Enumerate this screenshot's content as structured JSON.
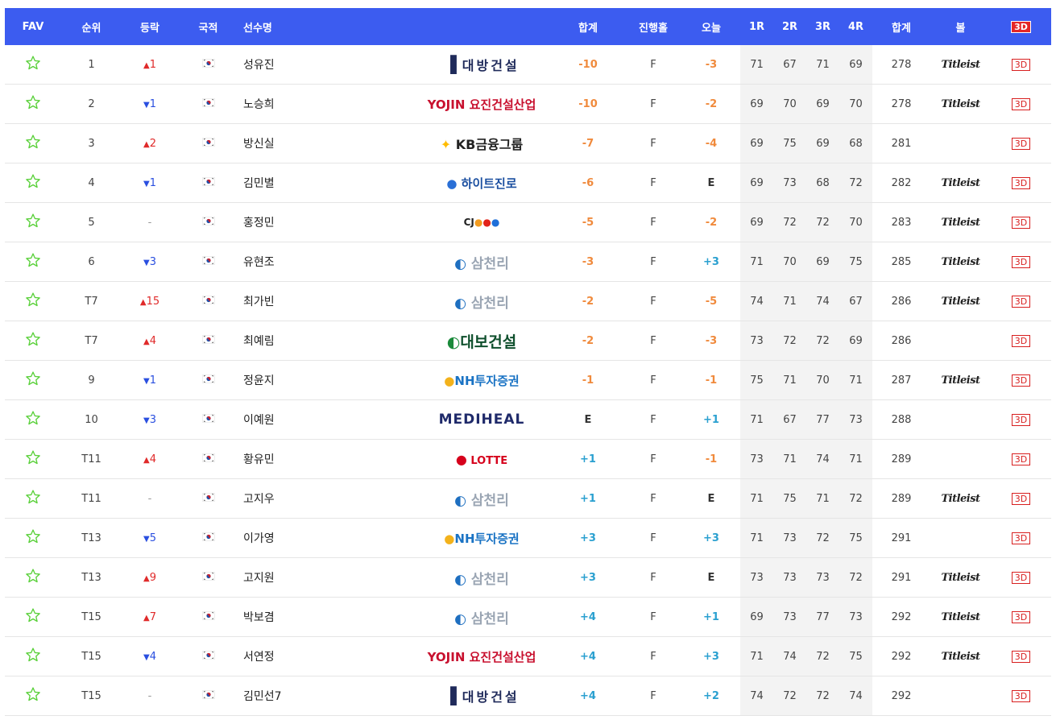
{
  "columns": {
    "fav": "FAV",
    "rank": "순위",
    "movement": "등락",
    "nationality": "국적",
    "player": "선수명",
    "total_to_par": "합계",
    "thru": "진행홀",
    "today": "오늘",
    "r1": "1R",
    "r2": "2R",
    "r3": "3R",
    "r4": "4R",
    "total_strokes": "합계",
    "ball": "볼",
    "view3d": "3D"
  },
  "colors": {
    "header_bg": "#3c5cf0",
    "up": "#e02a2a",
    "down": "#2a4fe0",
    "under_par": "#f08a3c",
    "over_par": "#2aa0d0",
    "star": "#59d039"
  },
  "rows": [
    {
      "rank": "1",
      "dir": "up",
      "move": "1",
      "flag": "korea-flag-icon",
      "name": "성유진",
      "sponsor": "대방건설",
      "sponsor_key": "daebang",
      "total": "-10",
      "total_class": "neg",
      "thru": "F",
      "today": "-3",
      "today_class": "neg",
      "r1": "71",
      "r2": "67",
      "r3": "71",
      "r4": "69",
      "strokes": "278",
      "ball": "Titleist",
      "btn": "3D"
    },
    {
      "rank": "2",
      "dir": "down",
      "move": "1",
      "flag": "korea-flag-icon",
      "name": "노승희",
      "sponsor": "YOJIN 요진건설산업",
      "sponsor_key": "yojin",
      "total": "-10",
      "total_class": "neg",
      "thru": "F",
      "today": "-2",
      "today_class": "neg",
      "r1": "69",
      "r2": "70",
      "r3": "69",
      "r4": "70",
      "strokes": "278",
      "ball": "Titleist",
      "btn": "3D"
    },
    {
      "rank": "3",
      "dir": "up",
      "move": "2",
      "flag": "korea-flag-icon",
      "name": "방신실",
      "sponsor": "KB금융그룹",
      "sponsor_key": "kb",
      "total": "-7",
      "total_class": "neg",
      "thru": "F",
      "today": "-4",
      "today_class": "neg",
      "r1": "69",
      "r2": "75",
      "r3": "69",
      "r4": "68",
      "strokes": "281",
      "ball": "",
      "btn": "3D"
    },
    {
      "rank": "4",
      "dir": "down",
      "move": "1",
      "flag": "korea-flag-icon",
      "name": "김민별",
      "sponsor": "하이트진로",
      "sponsor_key": "hite",
      "total": "-6",
      "total_class": "neg",
      "thru": "F",
      "today": "E",
      "today_class": "even",
      "r1": "69",
      "r2": "73",
      "r3": "68",
      "r4": "72",
      "strokes": "282",
      "ball": "Titleist",
      "btn": "3D"
    },
    {
      "rank": "5",
      "dir": "same",
      "move": "-",
      "flag": "korea-flag-icon",
      "name": "홍정민",
      "sponsor": "CJ",
      "sponsor_key": "cj",
      "total": "-5",
      "total_class": "neg",
      "thru": "F",
      "today": "-2",
      "today_class": "neg",
      "r1": "69",
      "r2": "72",
      "r3": "72",
      "r4": "70",
      "strokes": "283",
      "ball": "Titleist",
      "btn": "3D"
    },
    {
      "rank": "6",
      "dir": "down",
      "move": "3",
      "flag": "korea-flag-icon",
      "name": "유현조",
      "sponsor": "삼천리",
      "sponsor_key": "samchully",
      "total": "-3",
      "total_class": "neg",
      "thru": "F",
      "today": "+3",
      "today_class": "pos",
      "r1": "71",
      "r2": "70",
      "r3": "69",
      "r4": "75",
      "strokes": "285",
      "ball": "Titleist",
      "btn": "3D"
    },
    {
      "rank": "T7",
      "dir": "up",
      "move": "15",
      "flag": "korea-flag-icon",
      "name": "최가빈",
      "sponsor": "삼천리",
      "sponsor_key": "samchully",
      "total": "-2",
      "total_class": "neg",
      "thru": "F",
      "today": "-5",
      "today_class": "neg",
      "r1": "74",
      "r2": "71",
      "r3": "74",
      "r4": "67",
      "strokes": "286",
      "ball": "Titleist",
      "btn": "3D"
    },
    {
      "rank": "T7",
      "dir": "up",
      "move": "4",
      "flag": "korea-flag-icon",
      "name": "최예림",
      "sponsor": "대보건설",
      "sponsor_key": "daebo",
      "total": "-2",
      "total_class": "neg",
      "thru": "F",
      "today": "-3",
      "today_class": "neg",
      "r1": "73",
      "r2": "72",
      "r3": "72",
      "r4": "69",
      "strokes": "286",
      "ball": "",
      "btn": "3D"
    },
    {
      "rank": "9",
      "dir": "down",
      "move": "1",
      "flag": "korea-flag-icon",
      "name": "정윤지",
      "sponsor": "NH투자증권",
      "sponsor_key": "nh",
      "total": "-1",
      "total_class": "neg",
      "thru": "F",
      "today": "-1",
      "today_class": "neg",
      "r1": "75",
      "r2": "71",
      "r3": "70",
      "r4": "71",
      "strokes": "287",
      "ball": "Titleist",
      "btn": "3D"
    },
    {
      "rank": "10",
      "dir": "down",
      "move": "3",
      "flag": "korea-flag-icon",
      "name": "이예원",
      "sponsor": "MEDIHEAL",
      "sponsor_key": "mediheal",
      "total": "E",
      "total_class": "even",
      "thru": "F",
      "today": "+1",
      "today_class": "pos",
      "r1": "71",
      "r2": "67",
      "r3": "77",
      "r4": "73",
      "strokes": "288",
      "ball": "",
      "btn": "3D"
    },
    {
      "rank": "T11",
      "dir": "up",
      "move": "4",
      "flag": "korea-flag-icon",
      "name": "황유민",
      "sponsor": "LOTTE",
      "sponsor_key": "lotte",
      "total": "+1",
      "total_class": "pos",
      "thru": "F",
      "today": "-1",
      "today_class": "neg",
      "r1": "73",
      "r2": "71",
      "r3": "74",
      "r4": "71",
      "strokes": "289",
      "ball": "",
      "btn": "3D"
    },
    {
      "rank": "T11",
      "dir": "same",
      "move": "-",
      "flag": "korea-flag-icon",
      "name": "고지우",
      "sponsor": "삼천리",
      "sponsor_key": "samchully",
      "total": "+1",
      "total_class": "pos",
      "thru": "F",
      "today": "E",
      "today_class": "even",
      "r1": "71",
      "r2": "75",
      "r3": "71",
      "r4": "72",
      "strokes": "289",
      "ball": "Titleist",
      "btn": "3D"
    },
    {
      "rank": "T13",
      "dir": "down",
      "move": "5",
      "flag": "korea-flag-icon",
      "name": "이가영",
      "sponsor": "NH투자증권",
      "sponsor_key": "nh",
      "total": "+3",
      "total_class": "pos",
      "thru": "F",
      "today": "+3",
      "today_class": "pos",
      "r1": "71",
      "r2": "73",
      "r3": "72",
      "r4": "75",
      "strokes": "291",
      "ball": "",
      "btn": "3D"
    },
    {
      "rank": "T13",
      "dir": "up",
      "move": "9",
      "flag": "korea-flag-icon",
      "name": "고지원",
      "sponsor": "삼천리",
      "sponsor_key": "samchully",
      "total": "+3",
      "total_class": "pos",
      "thru": "F",
      "today": "E",
      "today_class": "even",
      "r1": "73",
      "r2": "73",
      "r3": "73",
      "r4": "72",
      "strokes": "291",
      "ball": "Titleist",
      "btn": "3D"
    },
    {
      "rank": "T15",
      "dir": "up",
      "move": "7",
      "flag": "korea-flag-icon",
      "name": "박보겸",
      "sponsor": "삼천리",
      "sponsor_key": "samchully",
      "total": "+4",
      "total_class": "pos",
      "thru": "F",
      "today": "+1",
      "today_class": "pos",
      "r1": "69",
      "r2": "73",
      "r3": "77",
      "r4": "73",
      "strokes": "292",
      "ball": "Titleist",
      "btn": "3D"
    },
    {
      "rank": "T15",
      "dir": "down",
      "move": "4",
      "flag": "korea-flag-icon",
      "name": "서연정",
      "sponsor": "YOJIN 요진건설산업",
      "sponsor_key": "yojin",
      "total": "+4",
      "total_class": "pos",
      "thru": "F",
      "today": "+3",
      "today_class": "pos",
      "r1": "71",
      "r2": "74",
      "r3": "72",
      "r4": "75",
      "strokes": "292",
      "ball": "Titleist",
      "btn": "3D"
    },
    {
      "rank": "T15",
      "dir": "same",
      "move": "-",
      "flag": "korea-flag-icon",
      "name": "김민선7",
      "sponsor": "대방건설",
      "sponsor_key": "daebang",
      "total": "+4",
      "total_class": "pos",
      "thru": "F",
      "today": "+2",
      "today_class": "pos",
      "r1": "74",
      "r2": "72",
      "r3": "72",
      "r4": "74",
      "strokes": "292",
      "ball": "",
      "btn": "3D"
    }
  ]
}
